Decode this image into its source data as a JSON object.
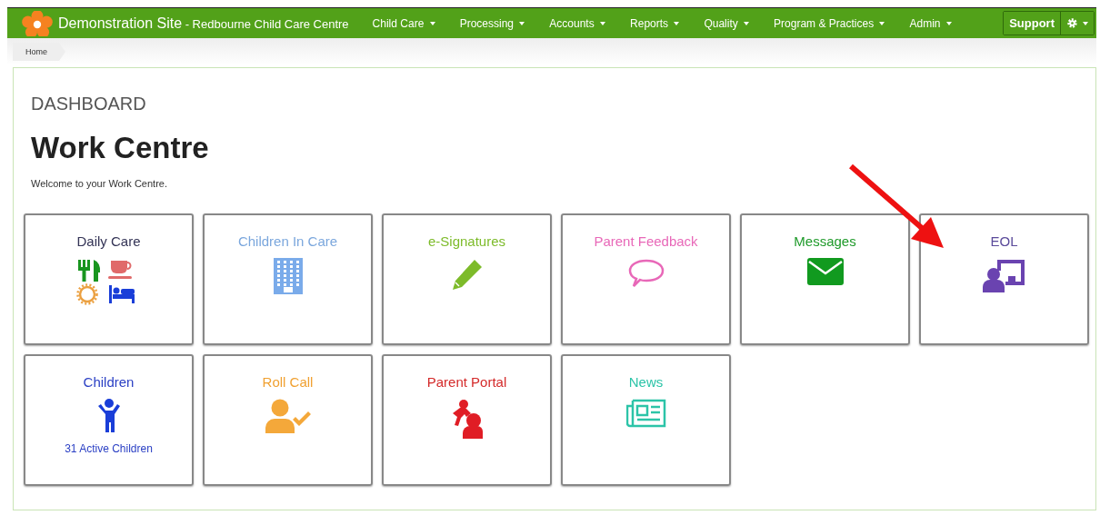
{
  "navbar": {
    "site": "Demonstration Site",
    "subtitle": "- Redbourne Child Care Centre",
    "menus": [
      "Child Care",
      "Processing",
      "Accounts",
      "Reports",
      "Quality",
      "Program & Practices",
      "Admin"
    ],
    "support": "Support"
  },
  "breadcrumb": [
    "Home"
  ],
  "heading": "DASHBOARD",
  "title": "Work Centre",
  "welcome": "Welcome to your Work Centre.",
  "tiles": [
    {
      "label": "Daily Care",
      "color": "#333355",
      "kind": "daily"
    },
    {
      "label": "Children In Care",
      "color": "#7ba7dd",
      "kind": "building"
    },
    {
      "label": "e-Signatures",
      "color": "#7dbb2a",
      "kind": "pencil"
    },
    {
      "label": "Parent Feedback",
      "color": "#e868b8",
      "kind": "speech"
    },
    {
      "label": "Messages",
      "color": "#1f9a2a",
      "kind": "envelope"
    },
    {
      "label": "EOL",
      "color": "#5a4a9a",
      "kind": "teacher"
    },
    {
      "label": "Children",
      "color": "#2a3fc4",
      "kind": "child",
      "note": "31 Active Children"
    },
    {
      "label": "Roll Call",
      "color": "#f0a030",
      "kind": "rollcall"
    },
    {
      "label": "Parent Portal",
      "color": "#d42a2a",
      "kind": "parent"
    },
    {
      "label": "News",
      "color": "#2cc4a8",
      "kind": "news"
    }
  ]
}
